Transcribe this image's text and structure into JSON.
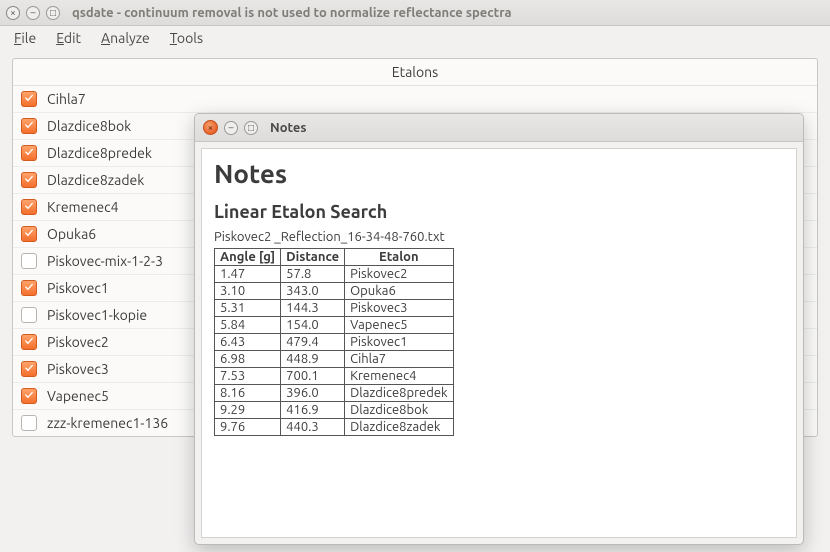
{
  "main_window": {
    "title": "qsdate - continuum removal is not used to normalize reflectance spectra"
  },
  "menubar": {
    "items": [
      {
        "label": "File",
        "ul": "F"
      },
      {
        "label": "Edit",
        "ul": "E"
      },
      {
        "label": "Analyze",
        "ul": "A"
      },
      {
        "label": "Tools",
        "ul": "T"
      }
    ]
  },
  "panel": {
    "title": "Etalons",
    "items": [
      {
        "label": "Cihla7",
        "checked": true
      },
      {
        "label": "Dlazdice8bok",
        "checked": true
      },
      {
        "label": "Dlazdice8predek",
        "checked": true
      },
      {
        "label": "Dlazdice8zadek",
        "checked": true
      },
      {
        "label": "Kremenec4",
        "checked": true
      },
      {
        "label": "Opuka6",
        "checked": true
      },
      {
        "label": "Piskovec-mix-1-2-3",
        "checked": false
      },
      {
        "label": "Piskovec1",
        "checked": true
      },
      {
        "label": "Piskovec1-kopie",
        "checked": false
      },
      {
        "label": "Piskovec2",
        "checked": true
      },
      {
        "label": "Piskovec3",
        "checked": true
      },
      {
        "label": "Vapenec5",
        "checked": true
      },
      {
        "label": "zzz-kremenec1-136",
        "checked": false
      }
    ]
  },
  "notes_window": {
    "title": "Notes",
    "heading": "Notes",
    "subheading": "Linear Etalon Search",
    "filename": "Piskovec2 _Reflection_16-34-48-760.txt",
    "columns": [
      "Angle [g]",
      "Distance",
      "Etalon"
    ]
  },
  "chart_data": {
    "type": "table",
    "title": "Linear Etalon Search",
    "columns": [
      "Angle [g]",
      "Distance",
      "Etalon"
    ],
    "rows": [
      {
        "angle": "1.47",
        "distance": "57.8",
        "etalon": "Piskovec2"
      },
      {
        "angle": "3.10",
        "distance": "343.0",
        "etalon": "Opuka6"
      },
      {
        "angle": "5.31",
        "distance": "144.3",
        "etalon": "Piskovec3"
      },
      {
        "angle": "5.84",
        "distance": "154.0",
        "etalon": "Vapenec5"
      },
      {
        "angle": "6.43",
        "distance": "479.4",
        "etalon": "Piskovec1"
      },
      {
        "angle": "6.98",
        "distance": "448.9",
        "etalon": "Cihla7"
      },
      {
        "angle": "7.53",
        "distance": "700.1",
        "etalon": "Kremenec4"
      },
      {
        "angle": "8.16",
        "distance": "396.0",
        "etalon": "Dlazdice8predek"
      },
      {
        "angle": "9.29",
        "distance": "416.9",
        "etalon": "Dlazdice8bok"
      },
      {
        "angle": "9.76",
        "distance": "440.3",
        "etalon": "Dlazdice8zadek"
      }
    ]
  }
}
